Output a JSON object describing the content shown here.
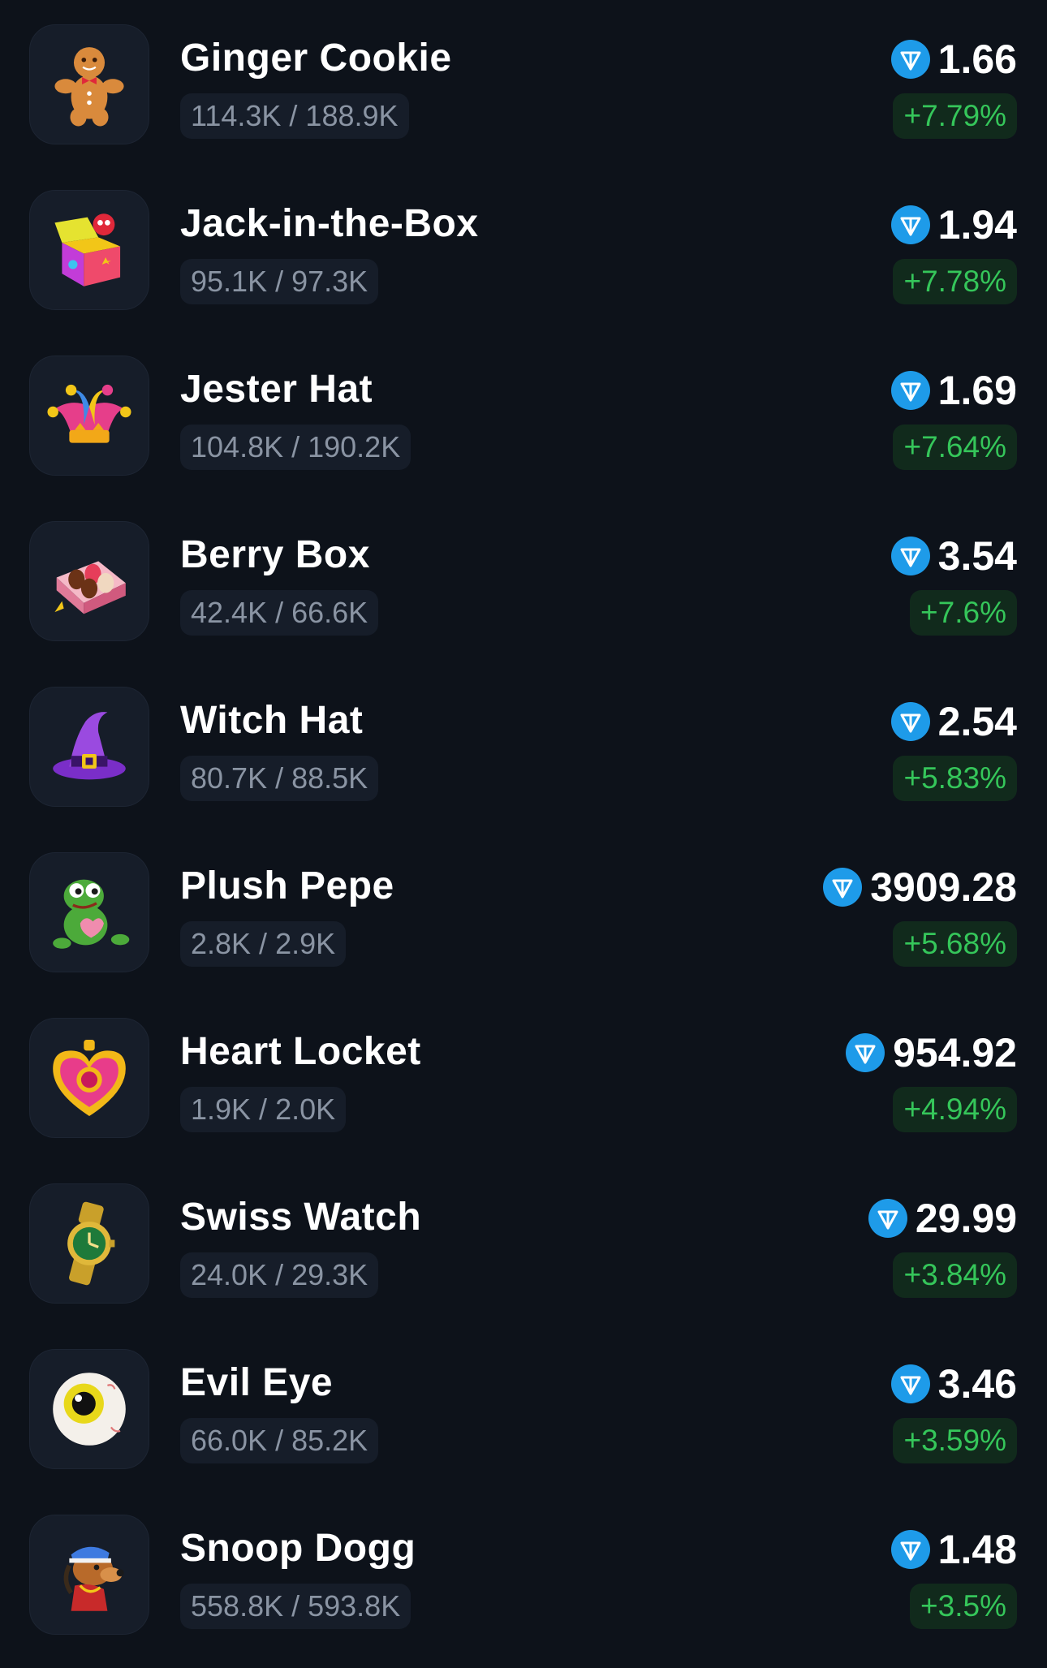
{
  "items": [
    {
      "name": "Ginger Cookie",
      "supply": "114.3K / 188.9K",
      "price": "1.66",
      "change": "+7.79%",
      "icon": "ginger-cookie-icon"
    },
    {
      "name": "Jack-in-the-Box",
      "supply": "95.1K / 97.3K",
      "price": "1.94",
      "change": "+7.78%",
      "icon": "jack-in-the-box-icon"
    },
    {
      "name": "Jester Hat",
      "supply": "104.8K / 190.2K",
      "price": "1.69",
      "change": "+7.64%",
      "icon": "jester-hat-icon"
    },
    {
      "name": "Berry Box",
      "supply": "42.4K / 66.6K",
      "price": "3.54",
      "change": "+7.6%",
      "icon": "berry-box-icon"
    },
    {
      "name": "Witch Hat",
      "supply": "80.7K / 88.5K",
      "price": "2.54",
      "change": "+5.83%",
      "icon": "witch-hat-icon"
    },
    {
      "name": "Plush Pepe",
      "supply": "2.8K / 2.9K",
      "price": "3909.28",
      "change": "+5.68%",
      "icon": "plush-pepe-icon"
    },
    {
      "name": "Heart Locket",
      "supply": "1.9K / 2.0K",
      "price": "954.92",
      "change": "+4.94%",
      "icon": "heart-locket-icon"
    },
    {
      "name": "Swiss Watch",
      "supply": "24.0K / 29.3K",
      "price": "29.99",
      "change": "+3.84%",
      "icon": "swiss-watch-icon"
    },
    {
      "name": "Evil Eye",
      "supply": "66.0K / 85.2K",
      "price": "3.46",
      "change": "+3.59%",
      "icon": "evil-eye-icon"
    },
    {
      "name": "Snoop Dogg",
      "supply": "558.8K / 593.8K",
      "price": "1.48",
      "change": "+3.5%",
      "icon": "snoop-dogg-icon"
    }
  ],
  "currency_icon": "ton-diamond-icon",
  "colors": {
    "background": "#0d121a",
    "card": "#161d29",
    "positive": "#35c65a",
    "positive_bg": "#112a1c",
    "ton_blue": "#1e9be9"
  }
}
